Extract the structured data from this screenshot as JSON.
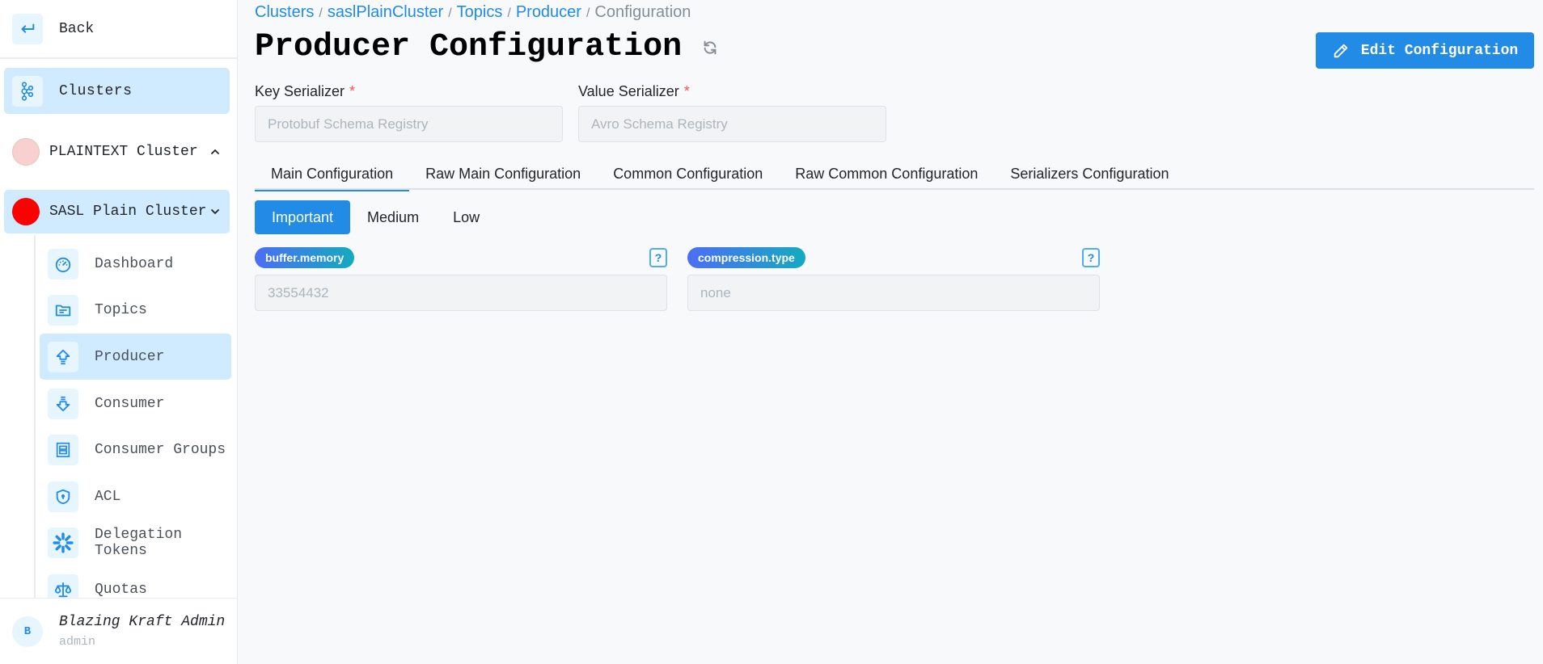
{
  "sidebar": {
    "back_label": "Back",
    "clusters_label": "Clusters",
    "clusters": [
      {
        "label": "PLAINTEXT Cluster",
        "color": "#f8d0d0",
        "expanded": false
      },
      {
        "label": "SASL Plain Cluster",
        "color": "#ff0000",
        "expanded": true
      }
    ],
    "nav_items": [
      {
        "label": "Dashboard",
        "icon": "gauge-icon"
      },
      {
        "label": "Topics",
        "icon": "folder-icon"
      },
      {
        "label": "Producer",
        "icon": "upload-arrow-icon",
        "active": true
      },
      {
        "label": "Consumer",
        "icon": "download-arrow-icon"
      },
      {
        "label": "Consumer Groups",
        "icon": "group-frame-icon"
      },
      {
        "label": "ACL",
        "icon": "shield-lock-icon"
      },
      {
        "label": "Delegation Tokens",
        "icon": "asterisk-icon"
      },
      {
        "label": "Quotas",
        "icon": "scale-icon"
      }
    ],
    "user": {
      "initial": "B",
      "name": "Blazing Kraft Admin",
      "role": "admin"
    }
  },
  "breadcrumb": {
    "items": [
      "Clusters",
      "saslPlainCluster",
      "Topics",
      "Producer"
    ],
    "current": "Configuration",
    "separator": "/"
  },
  "header": {
    "title": "Producer Configuration",
    "edit_button": "Edit Configuration"
  },
  "serializers": {
    "key": {
      "label": "Key Serializer",
      "required_mark": "*",
      "value": "Protobuf Schema Registry"
    },
    "value": {
      "label": "Value Serializer",
      "required_mark": "*",
      "value": "Avro Schema Registry"
    }
  },
  "tabs": [
    {
      "label": "Main Configuration",
      "active": true
    },
    {
      "label": "Raw Main Configuration"
    },
    {
      "label": "Common Configuration"
    },
    {
      "label": "Raw Common Configuration"
    },
    {
      "label": "Serializers Configuration"
    }
  ],
  "importance": {
    "options": [
      "Important",
      "Medium",
      "Low"
    ],
    "selected": "Important"
  },
  "configs": [
    {
      "key": "buffer.memory",
      "value": "33554432",
      "help": "?"
    },
    {
      "key": "compression.type",
      "value": "none",
      "help": "?"
    }
  ],
  "colors": {
    "accent": "#228be6",
    "active_bg": "#d0ebff"
  }
}
